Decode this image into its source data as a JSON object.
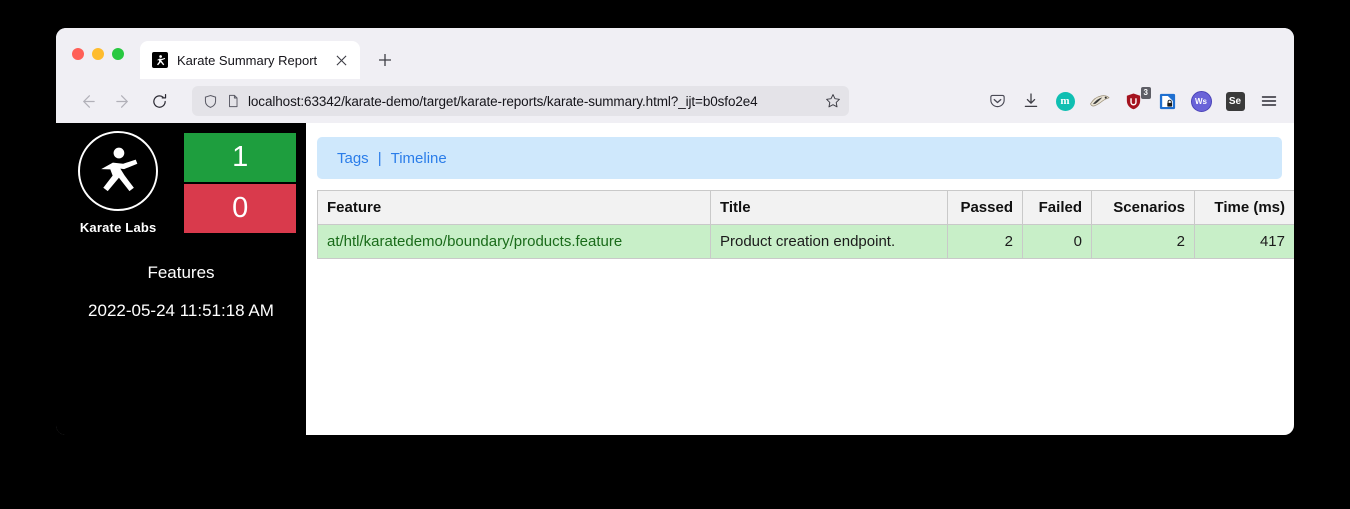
{
  "browser": {
    "traffic_lights": [
      "close",
      "minimize",
      "maximize"
    ],
    "tab": {
      "title": "Karate Summary Report",
      "favicon": "karate-figure-icon",
      "close_label": "✕"
    },
    "new_tab_label": "+",
    "nav": {
      "back_label": "←",
      "forward_label": "→",
      "reload_label": "⟳"
    },
    "url": "localhost:63342/karate-demo/target/karate-reports/karate-summary.html?_ijt=b0sfo2e4",
    "url_icons": [
      "shield-icon",
      "page-icon"
    ],
    "bookmark_icon": "star-icon",
    "toolbar_icons": [
      {
        "name": "pocket-icon",
        "label": ""
      },
      {
        "name": "downloads-icon",
        "label": ""
      },
      {
        "name": "extension-m-icon",
        "label": "m"
      },
      {
        "name": "extension-fox-icon",
        "label": ""
      },
      {
        "name": "extension-shield-icon",
        "label": "",
        "badge": "3"
      },
      {
        "name": "extension-lock-icon",
        "label": ""
      },
      {
        "name": "extension-ws-icon",
        "label": "Ws"
      },
      {
        "name": "extension-selenium-icon",
        "label": "Se"
      },
      {
        "name": "menu-icon",
        "label": ""
      }
    ]
  },
  "sidebar": {
    "logo_caption": "Karate Labs",
    "passed_count": "1",
    "failed_count": "0",
    "features_label": "Features",
    "timestamp": "2022-05-24 11:51:18 AM",
    "colors": {
      "passed": "#1e9e3e",
      "failed": "#d93a4c",
      "background": "#000000"
    }
  },
  "content": {
    "nav_banner": {
      "tags_label": "Tags",
      "separator": "|",
      "timeline_label": "Timeline",
      "background": "#cfe8fc",
      "link_color": "#2b7de9"
    },
    "table": {
      "headers": [
        "Feature",
        "Title",
        "Passed",
        "Failed",
        "Scenarios",
        "Time (ms)"
      ],
      "rows": [
        {
          "feature": "at/htl/karatedemo/boundary/products.feature",
          "title": "Product creation endpoint.",
          "passed": "2",
          "failed": "0",
          "scenarios": "2",
          "time": "417",
          "status": "pass",
          "row_background": "#c8efc8",
          "link_color": "#1a6b1a"
        }
      ]
    }
  }
}
